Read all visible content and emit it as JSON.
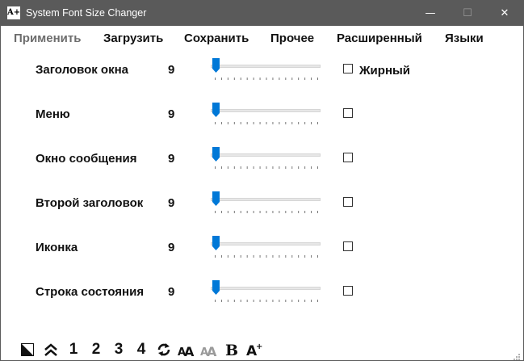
{
  "window": {
    "title": "System Font Size Changer",
    "icon_text": "A+",
    "controls": {
      "minimize": "—",
      "maximize": "☐",
      "close": "✕"
    }
  },
  "menu": {
    "apply": "Применить",
    "load": "Загрузить",
    "save": "Сохранить",
    "other": "Прочее",
    "advanced": "Расширенный",
    "languages": "Языки"
  },
  "settings": [
    {
      "label": "Заголовок окна",
      "value": "9",
      "slider_level": 0,
      "bold_checked": false,
      "bold_label": "Жирный"
    },
    {
      "label": "Меню",
      "value": "9",
      "slider_level": 0,
      "bold_checked": false
    },
    {
      "label": "Окно сообщения",
      "value": "9",
      "slider_level": 0,
      "bold_checked": false
    },
    {
      "label": "Второй заголовок",
      "value": "9",
      "slider_level": 0,
      "bold_checked": false
    },
    {
      "label": "Иконка",
      "value": "9",
      "slider_level": 0,
      "bold_checked": false
    },
    {
      "label": "Строка состояния",
      "value": "9",
      "slider_level": 0,
      "bold_checked": false
    }
  ],
  "toolbar": {
    "preset1": "1",
    "preset2": "2",
    "preset3": "3",
    "preset4": "4",
    "icons": [
      "contrast-icon",
      "double-chevron-up-icon",
      "refresh-icon",
      "font-size-icon",
      "font-size-disabled-icon",
      "bold-icon",
      "font-increase-icon"
    ]
  },
  "colors": {
    "titlebar": "#5a5a5a",
    "accent": "#0078d7",
    "disabled": "#9a9a9a"
  }
}
